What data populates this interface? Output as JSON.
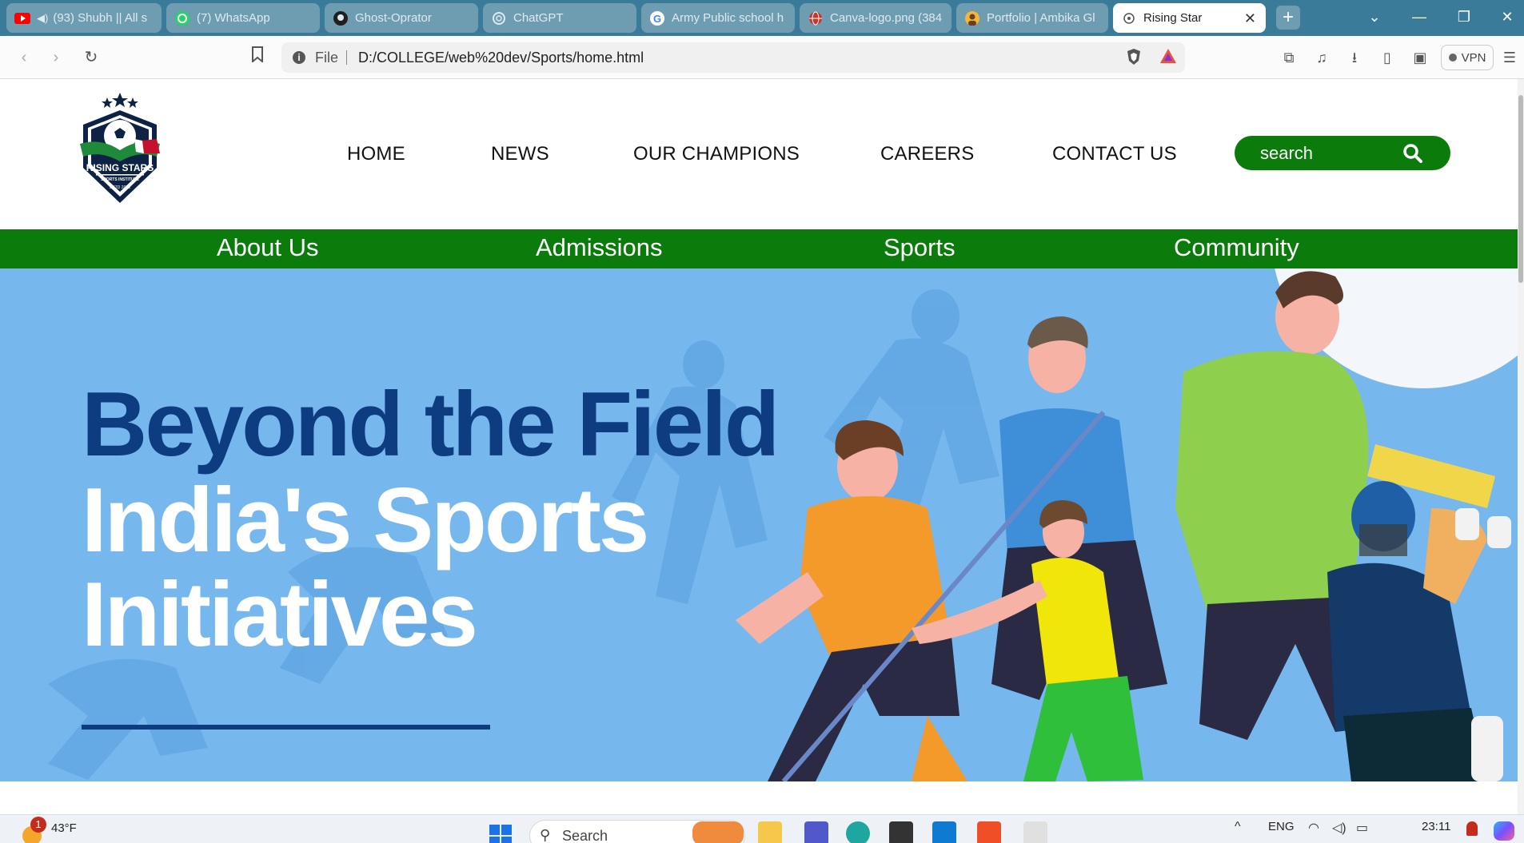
{
  "browser": {
    "tabs": [
      {
        "title": "(93) Shubh || All s",
        "icon": "youtube-icon",
        "muted": true
      },
      {
        "title": "(7) WhatsApp",
        "icon": "whatsapp-icon"
      },
      {
        "title": "Ghost-Oprator",
        "icon": "github-icon"
      },
      {
        "title": "ChatGPT",
        "icon": "chatgpt-icon"
      },
      {
        "title": "Army Public school h",
        "icon": "google-icon"
      },
      {
        "title": "Canva-logo.png (384",
        "icon": "globe-icon"
      },
      {
        "title": "Portfolio | Ambika Gl",
        "icon": "avatar-icon"
      },
      {
        "title": "Rising Star",
        "icon": "page-icon",
        "active": true
      }
    ],
    "address": {
      "scheme": "File",
      "url": "D:/COLLEGE/web%20dev/Sports/home.html"
    },
    "vpn_label": "VPN"
  },
  "site": {
    "logo": {
      "name": "RISING STARS",
      "tagline": "SPORTS INSTITUTE",
      "est": "ESTD 2023"
    },
    "main_nav": [
      "HOME",
      "NEWS",
      "OUR CHAMPIONS",
      "CAREERS",
      "CONTACT US"
    ],
    "search_placeholder": "search",
    "sub_nav": [
      "About Us",
      "Admissions",
      "Sports",
      "Community"
    ],
    "hero": {
      "line1": "Beyond the Field",
      "line2": "India's Sports",
      "line3": "Initiatives"
    }
  },
  "taskbar": {
    "weather": {
      "temp": "43°F",
      "badge": "1"
    },
    "search_label": "Search",
    "lang": "ENG",
    "time": "23:11"
  },
  "colors": {
    "brand_green": "#0b7c0b",
    "hero_blue": "#76b7ee",
    "headline_navy": "#0d3d80"
  }
}
